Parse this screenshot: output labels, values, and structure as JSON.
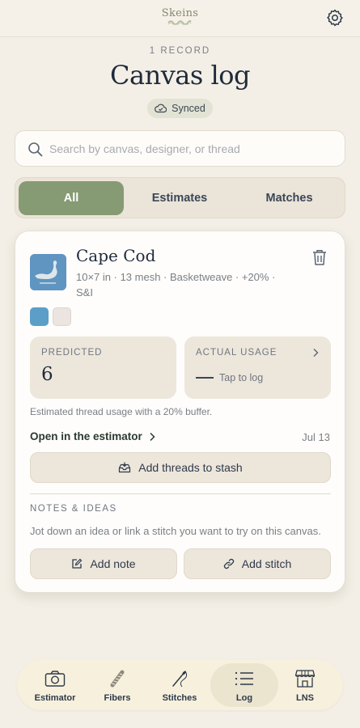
{
  "app": {
    "logo_text": "Skeins"
  },
  "header": {
    "record_count": "1 RECORD",
    "title": "Canvas log",
    "sync_status": "Synced"
  },
  "search": {
    "placeholder": "Search by canvas, designer, or thread",
    "value": ""
  },
  "filters": {
    "options": [
      "All",
      "Estimates",
      "Matches"
    ],
    "selected": "All"
  },
  "record": {
    "title": "Cape Cod",
    "meta": "10×7 in · 13 mesh · Basketweave · +20% · S&I",
    "swatch_colors": [
      "#5b9fc9",
      "#ebe4e1"
    ],
    "predicted_label": "PREDICTED",
    "predicted_value": "6",
    "actual_label": "ACTUAL USAGE",
    "actual_hint": "Tap to log",
    "buffer_note": "Estimated thread usage with a 20% buffer.",
    "open_estimator_label": "Open in the estimator",
    "date": "Jul 13",
    "add_threads_label": "Add threads to stash",
    "notes_heading": "NOTES & IDEAS",
    "notes_hint": "Jot down an idea or link a stitch you want to try on this canvas.",
    "add_note_label": "Add note",
    "add_stitch_label": "Add stitch"
  },
  "tabbar": {
    "items": [
      {
        "label": "Estimator",
        "icon": "camera-icon"
      },
      {
        "label": "Fibers",
        "icon": "skein-icon"
      },
      {
        "label": "Stitches",
        "icon": "needle-icon"
      },
      {
        "label": "Log",
        "icon": "list-icon"
      },
      {
        "label": "LNS",
        "icon": "storefront-icon"
      }
    ],
    "active": "Log"
  },
  "colors": {
    "accent_green": "#869a73",
    "background": "#f3efe6",
    "card": "#fefdfb",
    "tile": "#ede6db"
  }
}
